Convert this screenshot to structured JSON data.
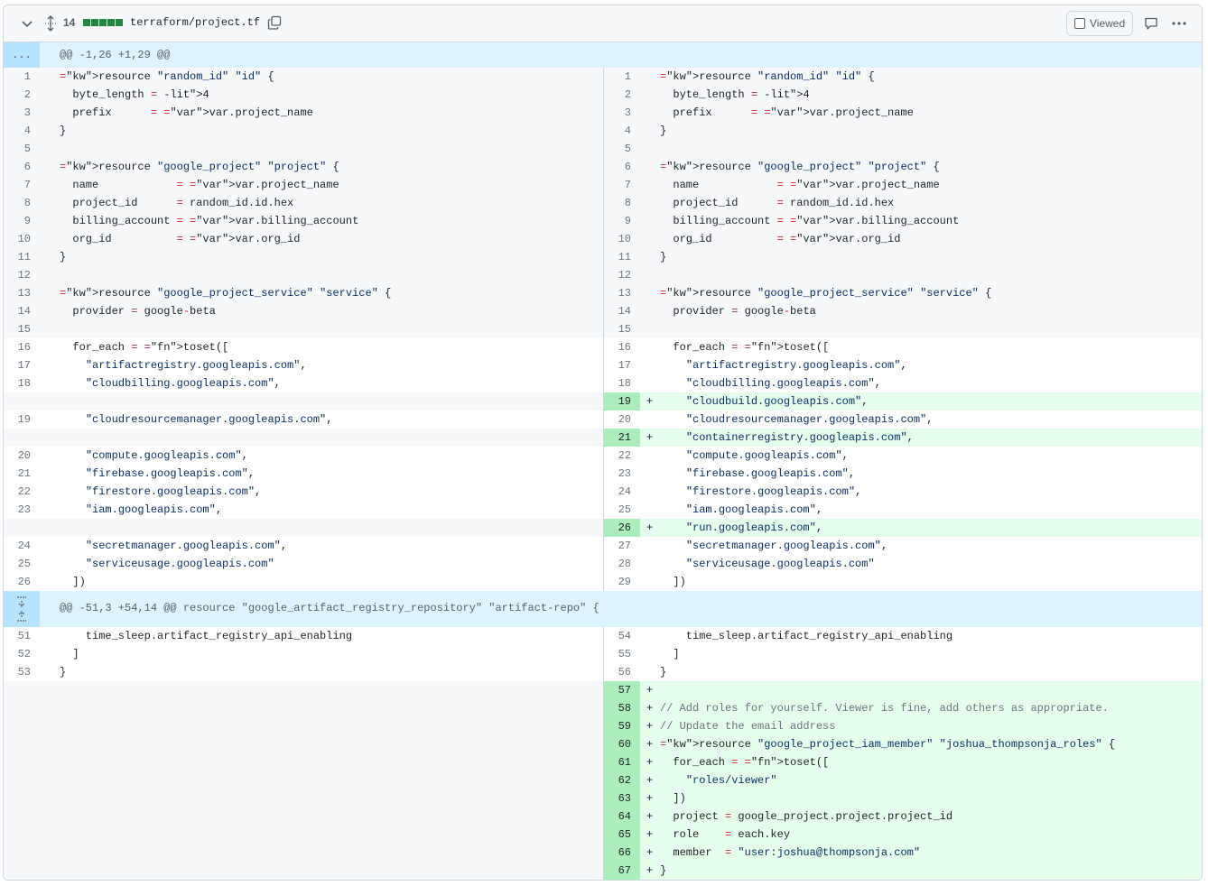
{
  "header": {
    "changes_count": "14",
    "filename": "terraform/project.tf",
    "viewed_label": "Viewed"
  },
  "hunks": [
    {
      "label": "...",
      "text": "@@ -1,26 +1,29 @@"
    },
    {
      "label": "",
      "text": "@@ -51,3 +54,14 @@ resource \"google_artifact_registry_repository\" \"artifact-repo\" {"
    }
  ],
  "lines": [
    {
      "l": "1",
      "r": "1",
      "t": "resource \"random_id\" \"id\" {",
      "k": "hidden"
    },
    {
      "l": "2",
      "r": "2",
      "t": "  byte_length = 4",
      "k": "hidden"
    },
    {
      "l": "3",
      "r": "3",
      "t": "  prefix      = var.project_name",
      "k": "hidden"
    },
    {
      "l": "4",
      "r": "4",
      "t": "}",
      "k": "hidden"
    },
    {
      "l": "5",
      "r": "5",
      "t": "",
      "k": "hidden"
    },
    {
      "l": "6",
      "r": "6",
      "t": "resource \"google_project\" \"project\" {",
      "k": "hidden"
    },
    {
      "l": "7",
      "r": "7",
      "t": "  name            = var.project_name",
      "k": "hidden"
    },
    {
      "l": "8",
      "r": "8",
      "t": "  project_id      = random_id.id.hex",
      "k": "hidden"
    },
    {
      "l": "9",
      "r": "9",
      "t": "  billing_account = var.billing_account",
      "k": "hidden"
    },
    {
      "l": "10",
      "r": "10",
      "t": "  org_id          = var.org_id",
      "k": "hidden"
    },
    {
      "l": "11",
      "r": "11",
      "t": "}",
      "k": "hidden"
    },
    {
      "l": "12",
      "r": "12",
      "t": "",
      "k": "hidden"
    },
    {
      "l": "13",
      "r": "13",
      "t": "resource \"google_project_service\" \"service\" {",
      "k": "hidden"
    },
    {
      "l": "14",
      "r": "14",
      "t": "  provider = google-beta",
      "k": "hidden"
    },
    {
      "l": "15",
      "r": "15",
      "t": "",
      "k": "hidden"
    },
    {
      "l": "16",
      "r": "16",
      "t": "  for_each = toset([",
      "k": "ctx"
    },
    {
      "l": "17",
      "r": "17",
      "t": "    \"artifactregistry.googleapis.com\",",
      "k": "ctx"
    },
    {
      "l": "18",
      "r": "18",
      "t": "    \"cloudbilling.googleapis.com\",",
      "k": "ctx"
    },
    {
      "l": "",
      "r": "19",
      "t": "    \"cloudbuild.googleapis.com\",",
      "k": "add"
    },
    {
      "l": "19",
      "r": "20",
      "t": "    \"cloudresourcemanager.googleapis.com\",",
      "k": "ctx"
    },
    {
      "l": "",
      "r": "21",
      "t": "    \"containerregistry.googleapis.com\",",
      "k": "add"
    },
    {
      "l": "20",
      "r": "22",
      "t": "    \"compute.googleapis.com\",",
      "k": "ctx"
    },
    {
      "l": "21",
      "r": "23",
      "t": "    \"firebase.googleapis.com\",",
      "k": "ctx"
    },
    {
      "l": "22",
      "r": "24",
      "t": "    \"firestore.googleapis.com\",",
      "k": "ctx"
    },
    {
      "l": "23",
      "r": "25",
      "t": "    \"iam.googleapis.com\",",
      "k": "ctx"
    },
    {
      "l": "",
      "r": "26",
      "t": "    \"run.googleapis.com\",",
      "k": "add"
    },
    {
      "l": "24",
      "r": "27",
      "t": "    \"secretmanager.googleapis.com\",",
      "k": "ctx"
    },
    {
      "l": "25",
      "r": "28",
      "t": "    \"serviceusage.googleapis.com\"",
      "k": "ctx"
    },
    {
      "l": "26",
      "r": "29",
      "t": "  ])",
      "k": "ctx"
    },
    {
      "hunk": 1
    },
    {
      "l": "51",
      "r": "54",
      "t": "    time_sleep.artifact_registry_api_enabling",
      "k": "ctx"
    },
    {
      "l": "52",
      "r": "55",
      "t": "  ]",
      "k": "ctx"
    },
    {
      "l": "53",
      "r": "56",
      "t": "}",
      "k": "ctx"
    },
    {
      "l": "",
      "r": "57",
      "t": "",
      "k": "add"
    },
    {
      "l": "",
      "r": "58",
      "t": "// Add roles for yourself. Viewer is fine, add others as appropriate.",
      "k": "add"
    },
    {
      "l": "",
      "r": "59",
      "t": "// Update the email address",
      "k": "add"
    },
    {
      "l": "",
      "r": "60",
      "t": "resource \"google_project_iam_member\" \"joshua_thompsonja_roles\" {",
      "k": "add"
    },
    {
      "l": "",
      "r": "61",
      "t": "  for_each = toset([",
      "k": "add"
    },
    {
      "l": "",
      "r": "62",
      "t": "    \"roles/viewer\"",
      "k": "add"
    },
    {
      "l": "",
      "r": "63",
      "t": "  ])",
      "k": "add"
    },
    {
      "l": "",
      "r": "64",
      "t": "  project = google_project.project.project_id",
      "k": "add"
    },
    {
      "l": "",
      "r": "65",
      "t": "  role    = each.key",
      "k": "add"
    },
    {
      "l": "",
      "r": "66",
      "t": "  member  = \"user:joshua@thompsonja.com\"",
      "k": "add"
    },
    {
      "l": "",
      "r": "67",
      "t": "}",
      "k": "add"
    }
  ],
  "icons": {
    "collapse": "chevron-down-icon",
    "expand_all": "unfold-icon",
    "copy": "copy-icon",
    "comment": "comment-icon",
    "more": "kebab-horizontal-icon"
  }
}
